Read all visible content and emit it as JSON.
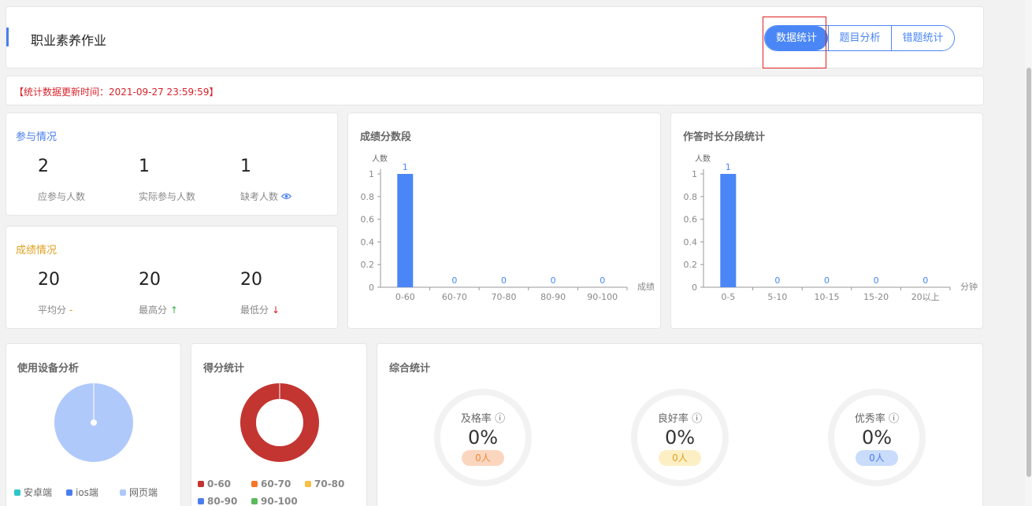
{
  "header": {
    "title": "职业素养作业",
    "tabs": [
      "数据统计",
      "题目分析",
      "错题统计"
    ]
  },
  "notice": "【统计数据更新时间：2021-09-27 23:59:59】",
  "participation": {
    "title": "参与情况",
    "stats": [
      {
        "value": "2",
        "label": "应参与人数"
      },
      {
        "value": "1",
        "label": "实际参与人数"
      },
      {
        "value": "1",
        "label": "缺考人数",
        "icon": "eye-icon"
      }
    ]
  },
  "scores": {
    "title": "成绩情况",
    "stats": [
      {
        "value": "20",
        "label": "平均分",
        "suffix": "-"
      },
      {
        "value": "20",
        "label": "最高分",
        "suffix": "↑"
      },
      {
        "value": "20",
        "label": "最低分",
        "suffix": "↓"
      }
    ]
  },
  "chart_data": [
    {
      "type": "bar",
      "title": "成绩分数段",
      "ylabel": "人数",
      "xlabel": "成绩",
      "categories": [
        "0-60",
        "60-70",
        "70-80",
        "80-90",
        "90-100"
      ],
      "values": [
        1,
        0,
        0,
        0,
        0
      ],
      "ylim": [
        0,
        1
      ],
      "yticks": [
        "0",
        "0.2",
        "0.4",
        "0.6",
        "0.8",
        "1"
      ],
      "color": "#4a86f5"
    },
    {
      "type": "bar",
      "title": "作答时长分段统计",
      "ylabel": "人数",
      "xlabel": "分钟",
      "categories": [
        "0-5",
        "5-10",
        "10-15",
        "15-20",
        "20以上"
      ],
      "values": [
        1,
        0,
        0,
        0,
        0
      ],
      "ylim": [
        0,
        1
      ],
      "yticks": [
        "0",
        "0.2",
        "0.4",
        "0.6",
        "0.8",
        "1"
      ],
      "color": "#4a86f5"
    },
    {
      "type": "pie",
      "title": "使用设备分析",
      "categories": [
        "安卓端",
        "ios端",
        "网页端"
      ],
      "values": [
        0,
        0,
        1
      ],
      "colors": [
        "#2ec7c9",
        "#4a7ef0",
        "#b0c9fb"
      ]
    },
    {
      "type": "pie",
      "title": "得分统计",
      "categories": [
        "0-60",
        "60-70",
        "70-80",
        "80-90",
        "90-100"
      ],
      "values": [
        1,
        0,
        0,
        0,
        0
      ],
      "colors": [
        "#c23531",
        "#f5772b",
        "#f5c044",
        "#4a7ef0",
        "#5cb85c"
      ]
    }
  ],
  "summary": {
    "title": "综合统计",
    "rings": [
      {
        "label": "及格率",
        "icon": "info-icon",
        "pct": "0%",
        "count": "0人",
        "pill_bg": "#fbd6bf",
        "pill_color": "#f08a3c"
      },
      {
        "label": "良好率",
        "icon": "info-icon",
        "pct": "0%",
        "count": "0人",
        "pill_bg": "#fcefc4",
        "pill_color": "#e0a020"
      },
      {
        "label": "优秀率",
        "icon": "info-icon",
        "pct": "0%",
        "count": "0人",
        "pill_bg": "#c9dcfb",
        "pill_color": "#4a7ef0"
      }
    ]
  }
}
